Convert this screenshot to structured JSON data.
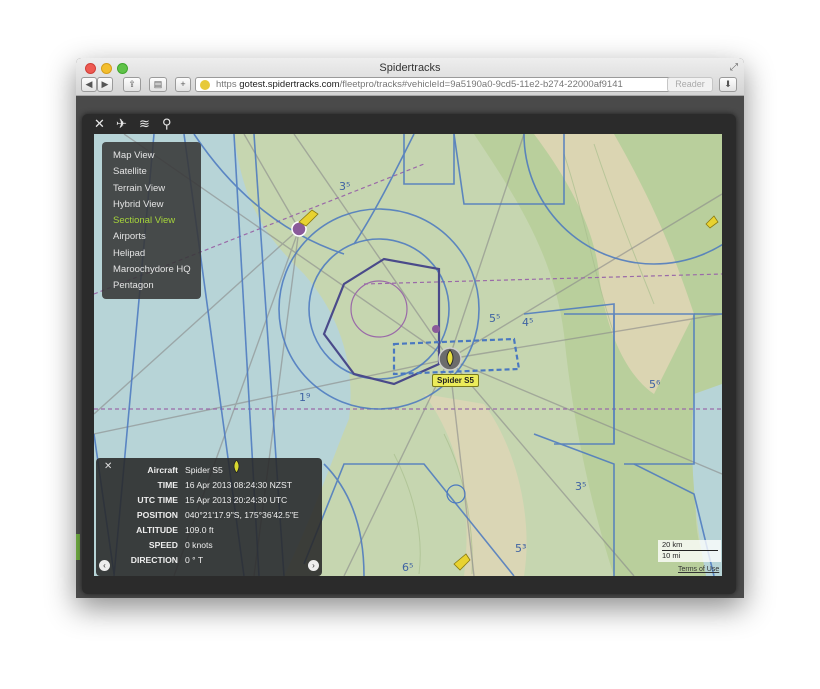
{
  "browser": {
    "window_title": "Spidertracks",
    "url_scheme": "https",
    "url_host": "gotest.spidertracks.com",
    "url_path": "/fleetpro/tracks#vehicleId=9a5190a0-9cd5-11e2-b274-22000af9141",
    "reader_label": "Reader",
    "back_label": "◀",
    "forward_label": "▶",
    "add_label": "+"
  },
  "map_menu": {
    "items": [
      {
        "label": "Map View"
      },
      {
        "label": "Satellite"
      },
      {
        "label": "Terrain View"
      },
      {
        "label": "Hybrid View"
      },
      {
        "label": "Sectional View",
        "active": true
      },
      {
        "label": "Airports"
      },
      {
        "label": "Helipad"
      },
      {
        "label": "Maroochydore HQ"
      },
      {
        "label": "Pentagon"
      }
    ]
  },
  "aircraft_label": "Spider S5",
  "info_panel": {
    "close_label": "✕",
    "rows": [
      {
        "label": "Aircraft",
        "value": "Spider S5"
      },
      {
        "label": "TIME",
        "value": "16 Apr 2013 08:24:30 NZST"
      },
      {
        "label": "UTC Time",
        "value": "15 Apr 2013 20:24:30 UTC"
      },
      {
        "label": "POSITION",
        "value": "040°21'17.9\"S, 175°36'42.5\"E"
      },
      {
        "label": "ALTITUDE",
        "value": "109.0 ft"
      },
      {
        "label": "SPEED",
        "value": "0 knots"
      },
      {
        "label": "DIRECTION",
        "value": "0 ° T"
      }
    ],
    "prev_label": "‹",
    "next_label": "›"
  },
  "scale": {
    "km": "20 km",
    "mi": "10 mi"
  },
  "terms_label": "Terms of Use",
  "map_numbers": [
    "3⁵",
    "4⁵",
    "5⁶",
    "1⁹",
    "3⁵",
    "5³",
    "6⁵",
    "5⁵"
  ],
  "colors": {
    "accent_active": "#a6d43b",
    "aircraft_label_bg": "#ecec5a",
    "airspace_blue": "#4a78c0",
    "map_water": "#b7d4d7",
    "map_land": "#c9d8b4"
  }
}
